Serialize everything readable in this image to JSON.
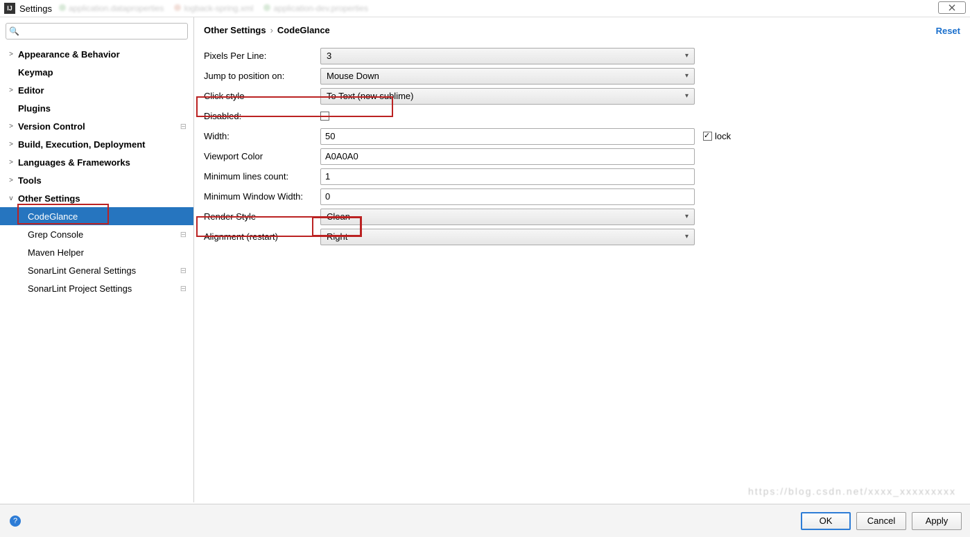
{
  "window": {
    "title": "Settings"
  },
  "blurTabs": [
    "application.dataproperties",
    "logback-spring.xml",
    "application-dev.properties"
  ],
  "sidebar": {
    "searchPlaceholder": "",
    "items": [
      {
        "label": "Appearance & Behavior",
        "bold": true,
        "chev": ">"
      },
      {
        "label": "Keymap",
        "bold": true,
        "chev": ""
      },
      {
        "label": "Editor",
        "bold": true,
        "chev": ">"
      },
      {
        "label": "Plugins",
        "bold": true,
        "chev": ""
      },
      {
        "label": "Version Control",
        "bold": true,
        "chev": ">",
        "gear": true
      },
      {
        "label": "Build, Execution, Deployment",
        "bold": true,
        "chev": ">"
      },
      {
        "label": "Languages & Frameworks",
        "bold": true,
        "chev": ">"
      },
      {
        "label": "Tools",
        "bold": true,
        "chev": ">"
      },
      {
        "label": "Other Settings",
        "bold": true,
        "chev": "v"
      }
    ],
    "subItems": [
      {
        "label": "CodeGlance",
        "selected": true
      },
      {
        "label": "Grep Console",
        "gear": true
      },
      {
        "label": "Maven Helper"
      },
      {
        "label": "SonarLint General Settings",
        "gear": true
      },
      {
        "label": "SonarLint Project Settings",
        "gear": true
      }
    ]
  },
  "breadcrumb": {
    "a": "Other Settings",
    "b": "CodeGlance"
  },
  "reset": "Reset",
  "fields": {
    "pixelsPerLine": {
      "label": "Pixels Per Line:",
      "value": "3"
    },
    "jumpTo": {
      "label": "Jump to position on:",
      "value": "Mouse Down"
    },
    "clickStyle": {
      "label": "Click style",
      "value": "To Text (new sublime)"
    },
    "disabled": {
      "label": "Disabled:"
    },
    "width": {
      "label": "Width:",
      "value": "50"
    },
    "lock": {
      "label": "lock"
    },
    "viewportColor": {
      "label": "Viewport Color",
      "value": "A0A0A0"
    },
    "minLines": {
      "label": "Minimum lines count:",
      "value": "1"
    },
    "minWinWidth": {
      "label": "Minimum Window Width:",
      "value": "0"
    },
    "renderStyle": {
      "label": "Render Style",
      "value": "Clean"
    },
    "alignment": {
      "label": "Alignment (restart)",
      "value": "Right"
    }
  },
  "footer": {
    "ok": "OK",
    "cancel": "Cancel",
    "apply": "Apply"
  }
}
